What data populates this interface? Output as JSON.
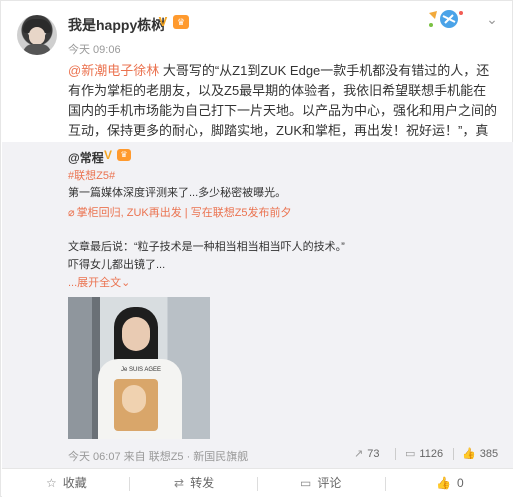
{
  "post": {
    "author": "我是happy栋树",
    "time": "今天 09:06",
    "mention": "@新潮电子徐林",
    "text": " 大哥写的“从Z1到ZUK Edge一款手机都没有错过的人，还有作为掌柜的老朋友，以及Z5最早期的体验者，我依旧希望联想手机能在国内的手机市场能为自己打下一片天地。以产品为中心，强化和用户之间的互动，保持更多的耐心，脚踏实地，ZUK和掌柜，再出发！祝好运！”，真情流露，超级感动！"
  },
  "repost": {
    "author": "@常程",
    "tag": "#联想Z5#",
    "text": "第一篇媒体深度评测来了...多少秘密被曝光。",
    "links": "掌柜回归, ZUK再出发 | 写在联想Z5发布前夕",
    "quote1": "文章最后说：“粒子技术是一种相当相当相当吓人的技术。”",
    "quote2": "吓得女儿都出镜了...",
    "expand": "展开全文",
    "expand_icon": "chevron-down-icon",
    "shirt_text": "Je SUIS AGEE",
    "footer_time": "今天 06:07 来自 联想Z5 · 新国民旗舰",
    "shares": "73",
    "comments": "1126",
    "likes": "385"
  },
  "actions": {
    "favorite": "收藏",
    "repost": "转发",
    "comment": "评论",
    "like": "0"
  },
  "colors": {
    "accent": "#eb7350",
    "verified": "#f5a623"
  }
}
